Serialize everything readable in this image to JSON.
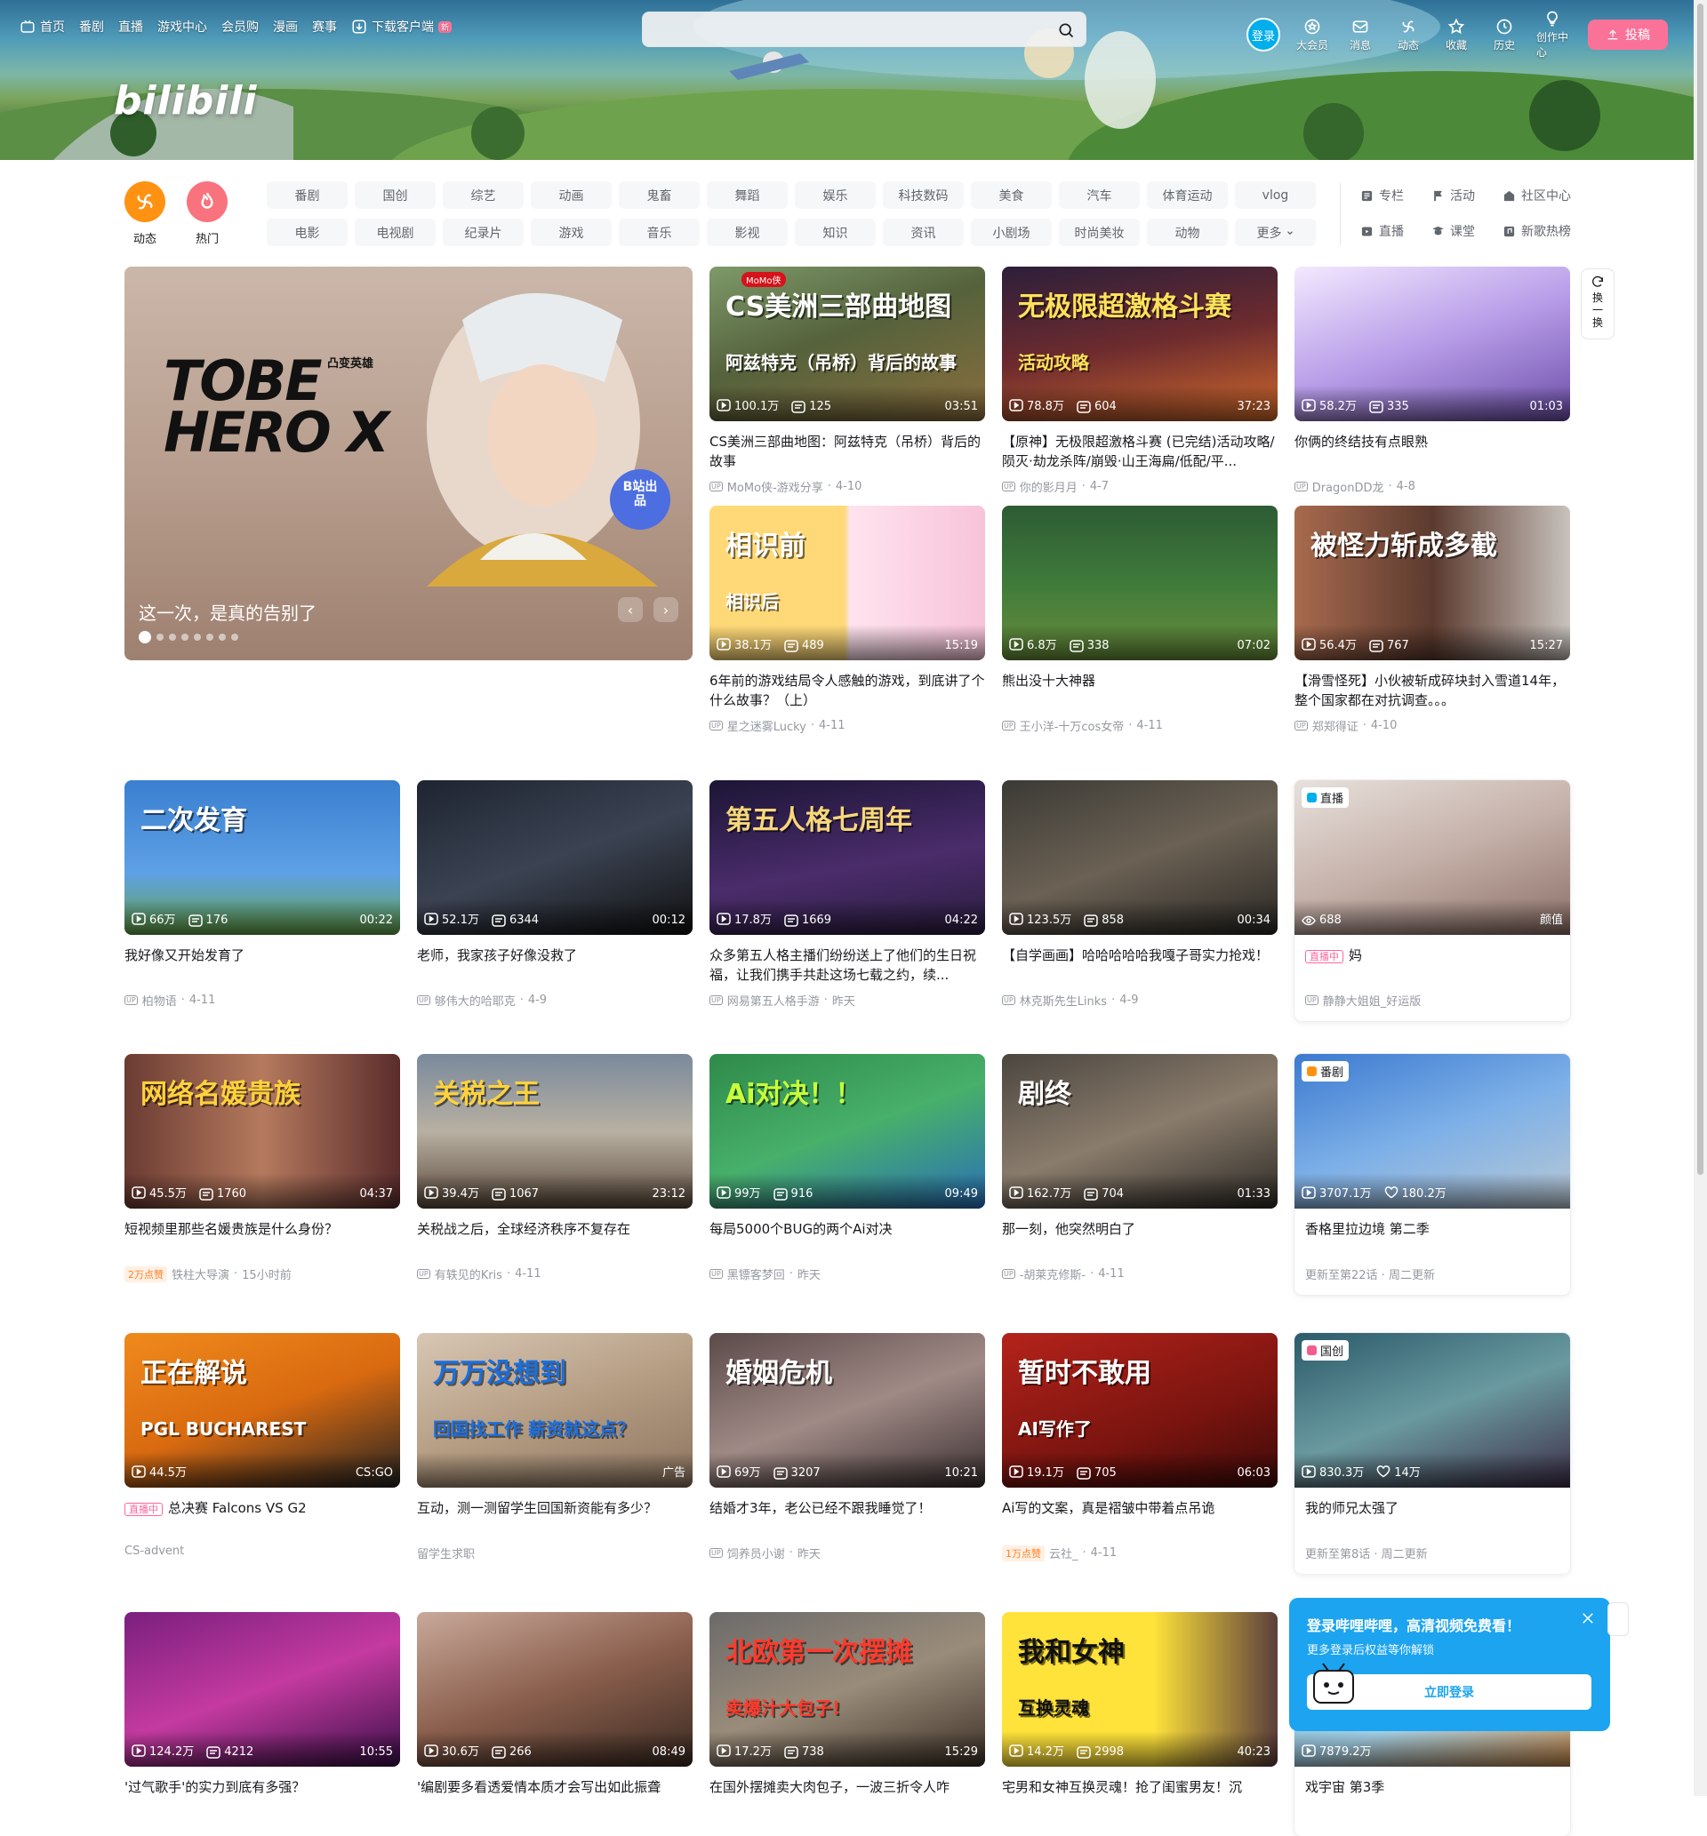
{
  "header": {
    "nav_left": [
      {
        "label": "首页",
        "icon": "tv-icon"
      },
      {
        "label": "番剧"
      },
      {
        "label": "直播"
      },
      {
        "label": "游戏中心"
      },
      {
        "label": "会员购"
      },
      {
        "label": "漫画"
      },
      {
        "label": "赛事"
      },
      {
        "label": "下载客户端",
        "icon": "download-icon",
        "badge": "新"
      }
    ],
    "logo_text": "bilibili",
    "search_placeholder": "",
    "login_label": "登录",
    "nav_right": [
      {
        "label": "大会员",
        "icon": "vip-icon"
      },
      {
        "label": "消息",
        "icon": "mail-icon"
      },
      {
        "label": "动态",
        "icon": "pinwheel-icon"
      },
      {
        "label": "收藏",
        "icon": "star-icon"
      },
      {
        "label": "历史",
        "icon": "clock-icon"
      },
      {
        "label": "创作中心",
        "icon": "bulb-icon"
      }
    ],
    "upload_label": "投稿"
  },
  "channels": {
    "circles": [
      {
        "label": "动态",
        "color": "#ff9212",
        "icon": "pinwheel-icon"
      },
      {
        "label": "热门",
        "color": "#f9737e",
        "icon": "flame-icon"
      }
    ],
    "categories": [
      "番剧",
      "国创",
      "综艺",
      "动画",
      "鬼畜",
      "舞蹈",
      "娱乐",
      "科技数码",
      "美食",
      "汽车",
      "体育运动",
      "vlog",
      "电影",
      "电视剧",
      "纪录片",
      "游戏",
      "音乐",
      "影视",
      "知识",
      "资讯",
      "小剧场",
      "时尚美妆",
      "动物",
      "更多"
    ],
    "extra_links": [
      {
        "label": "专栏",
        "icon": "column-icon"
      },
      {
        "label": "活动",
        "icon": "flag-icon"
      },
      {
        "label": "社区中心",
        "icon": "community-icon"
      },
      {
        "label": "直播",
        "icon": "live-icon"
      },
      {
        "label": "课堂",
        "icon": "class-icon"
      },
      {
        "label": "新歌热榜",
        "icon": "music-icon"
      }
    ]
  },
  "carousel": {
    "caption": "这一次，是真的告别了",
    "art_title": "TOBE HERO X",
    "art_subtitle": "凸变英雄",
    "badge": "B站出品",
    "dot_count": 8,
    "active_dot": 0
  },
  "refresh_label": [
    "换",
    "一",
    "换"
  ],
  "colors": {
    "brand_pink": "#fb7299",
    "brand_blue": "#00aeec",
    "popup_blue": "#1ca4f0"
  },
  "cards": [
    {
      "views": "100.1万",
      "danmaku": "125",
      "duration": "03:51",
      "title": "CS美洲三部曲地图：阿兹特克（吊桥）背后的故事",
      "author": "MoMo侠-游戏分享",
      "date": "4-10",
      "cover_text": "CS美洲三部曲地图",
      "cover_text2": "阿兹特克（吊桥）背后的故事",
      "tag_text": "MoMo侠",
      "bg": "linear-gradient(160deg,#7e9a6a,#55623c 45%,#8a6f3e 100%)",
      "tc": "#fff"
    },
    {
      "views": "78.8万",
      "danmaku": "604",
      "duration": "37:23",
      "title": "【原神】无极限超激格斗赛 (已完结)活动攻略/陨灭·劫龙杀阵/崩毁·山王海扁/低配/平...",
      "author": "你的影月月",
      "date": "4-7",
      "cover_text": "无极限超激格斗赛",
      "cover_text2": "活动攻略",
      "bg": "linear-gradient(170deg,#2c1f3a,#6d2b2e 50%,#d06a2c 100%)",
      "tc": "#ffe15a"
    },
    {
      "views": "58.2万",
      "danmaku": "335",
      "duration": "01:03",
      "title": "你俩的终结技有点眼熟",
      "author": "DragonDD龙",
      "date": "4-8",
      "cover_text": "",
      "bg": "linear-gradient(160deg,#f3e9ff,#b79ce8 50%,#6c4ea8 100%)",
      "tc": "#fff"
    },
    {
      "views": "38.1万",
      "danmaku": "489",
      "duration": "15:19",
      "title": "6年前的游戏结局令人感触的游戏，到底讲了个什么故事？（上）",
      "author": "星之迷雾Lucky",
      "date": "4-11",
      "cover_text": "相识前",
      "cover_text2": "相识后",
      "bg": "linear-gradient(90deg,#ffd978 0%,#ffd978 49%,#ffe3ef 51%,#f7c3d9 100%)",
      "tc": "#fff"
    },
    {
      "views": "6.8万",
      "danmaku": "338",
      "duration": "07:02",
      "title": "熊出没十大神器",
      "author": "王小洋-十万cos女帝",
      "date": "4-11",
      "cover_text": "",
      "bg": "linear-gradient(180deg,#2d5b34,#3f7a3a 50%,#6a8f3c 100%)",
      "tc": "#fff"
    },
    {
      "views": "56.4万",
      "danmaku": "767",
      "duration": "15:27",
      "title": "【滑雪怪死】小伙被斩成碎块封入雪道14年，整个国家都在对抗调查。。。",
      "author": "郑郑得证",
      "date": "4-10",
      "cover_text": "被怪力斩成多截",
      "bg": "linear-gradient(90deg,#a86a4e,#5b3a2e 50%,#c8c2bd 100%)",
      "tc": "#fff"
    },
    {
      "views": "66万",
      "danmaku": "176",
      "duration": "00:22",
      "title": "我好像又开始发育了",
      "author": "柏物语",
      "date": "4-11",
      "cover_text": "二次发育",
      "bg": "linear-gradient(180deg,#3a7fd0,#5ea1e6 60%,#66a44a 100%)",
      "tc": "#fff"
    },
    {
      "views": "52.1万",
      "danmaku": "6344",
      "duration": "00:12",
      "title": "老师，我家孩子好像没救了",
      "author": "够伟大的哈耶克",
      "date": "4-9",
      "cover_text": "",
      "bg": "linear-gradient(160deg,#1e2430,#3b4353 50%,#111 100%)",
      "tc": "#fff"
    },
    {
      "views": "17.8万",
      "danmaku": "1669",
      "duration": "04:22",
      "title": "众多第五人格主播们纷纷送上了他们的生日祝福，让我们携手共赴这场七载之约，续...",
      "author": "网易第五人格手游",
      "date": "昨天",
      "cover_text": "第五人格七周年",
      "bg": "linear-gradient(170deg,#1c1535,#4a2c6b 55%,#2b1d3f 100%)",
      "tc": "#f6d77b"
    },
    {
      "views": "123.5万",
      "danmaku": "858",
      "duration": "00:34",
      "title": "【自学画画】哈哈哈哈哈我嘎子哥实力抢戏！",
      "author": "林克斯先生Links",
      "date": "4-9",
      "cover_text": "",
      "bg": "linear-gradient(160deg,#3b3a35,#6b6154 50%,#2a2824 100%)",
      "tc": "#fff"
    },
    {
      "views": "2万点赞",
      "danmaku": "1760",
      "duration": "04:37",
      "title": "短视频里那些名媛贵族是什么身份？",
      "author": "铁柱大导演",
      "date": "15小时前",
      "cover_text": "网络名媛贵族",
      "bg": "linear-gradient(90deg,#6b3b32,#b57a5e 50%,#5a2c2c 100%)",
      "tc": "#ffd23b",
      "stats_views": "45.5万"
    },
    {
      "views": "39.4万",
      "danmaku": "1067",
      "duration": "23:12",
      "title": "关税战之后，全球经济秩序不复存在",
      "author": "有轶见的Kris",
      "date": "4-11",
      "cover_text": "关税之王",
      "bg": "linear-gradient(180deg,#7a8a9c,#b8b0a2 50%,#5b4a3c 100%)",
      "tc": "#ffd23b"
    },
    {
      "views": "99万",
      "danmaku": "916",
      "duration": "09:49",
      "title": "每局5000个BUG的两个Ai对决",
      "author": "黑镖客梦回",
      "date": "昨天",
      "cover_text": "Ai对决！！",
      "bg": "linear-gradient(160deg,#2f8a4a,#47b06a 50%,#2a6fb8 100%)",
      "tc": "#c7ff3a"
    },
    {
      "views": "162.7万",
      "danmaku": "704",
      "duration": "01:33",
      "title": "那一刻，他突然明白了",
      "author": "-胡莱克修斯-",
      "date": "4-11",
      "cover_text": "剧终",
      "bg": "linear-gradient(160deg,#4b4640,#8a7c6c 50%,#2d2a26 100%)",
      "tc": "#fff"
    },
    {
      "views": "44.5万",
      "danmaku": "",
      "duration": "CS:GO",
      "title": "总决赛 Falcons VS G2",
      "author": "CS-advent",
      "date": "",
      "cover_text": "正在解说",
      "cover_text2": "PGL BUCHAREST",
      "bg": "linear-gradient(160deg,#f08a1c,#d96a10 50%,#222 100%)",
      "tc": "#fff",
      "live": "直播中"
    },
    {
      "views": "",
      "danmaku": "",
      "duration": "广告",
      "title": "互动，测一测留学生回国新资能有多少？",
      "author": "留学生求职",
      "date": "",
      "cover_text": "万万没想到",
      "cover_text2": "回国找工作 薪资就这点？",
      "bg": "linear-gradient(160deg,#d8c7b4,#b59d83 50%,#8c7460 100%)",
      "tc": "#1a6fe0"
    },
    {
      "views": "69万",
      "danmaku": "3207",
      "duration": "10:21",
      "title": "结婚才3年，老公已经不跟我睡觉了！",
      "author": "饲养员小谢",
      "date": "昨天",
      "cover_text": "婚姻危机",
      "bg": "linear-gradient(160deg,#5b4a49,#a08a86 50%,#3b3031 100%)",
      "tc": "#fff"
    },
    {
      "views": "19.1万",
      "danmaku": "705",
      "duration": "06:03",
      "title": "Ai写的文案，真是褶皱中带着点吊诡",
      "author": "云社_",
      "date": "4-11",
      "cover_text": "暂时不敢用",
      "cover_text2": "AI写作了",
      "bg": "linear-gradient(160deg,#b4231b,#7a140f 60%,#3b0a08 100%)",
      "tc": "#fff",
      "hot": "1万点赞"
    },
    {
      "views": "124.2万",
      "danmaku": "4212",
      "duration": "10:55",
      "title": "'过气歌手'的实力到底有多强？",
      "author": "",
      "date": "",
      "cover_text": "",
      "bg": "linear-gradient(160deg,#7a1f7e,#c43aa0 50%,#3a0f48 100%)",
      "tc": "#fff"
    },
    {
      "views": "30.6万",
      "danmaku": "266",
      "duration": "08:49",
      "title": "'编剧要多看透爱情本质才会写出如此振聋",
      "author": "",
      "date": "",
      "cover_text": "",
      "bg": "linear-gradient(160deg,#c9a99a,#8a5e4c 50%,#3a2a22 100%)",
      "tc": "#fff"
    },
    {
      "views": "17.2万",
      "danmaku": "738",
      "duration": "15:29",
      "title": "在国外摆摊卖大肉包子，一波三折令人咋",
      "author": "",
      "date": "",
      "cover_text": "北欧第一次摆摊",
      "cover_text2": "卖爆汁大包子!",
      "bg": "linear-gradient(160deg,#6b6a6a,#9a8c7a 50%,#3d3026 100%)",
      "tc": "#ff3a2c"
    },
    {
      "views": "14.2万",
      "danmaku": "2998",
      "duration": "40:23",
      "title": "宅男和女神互换灵魂！抢了闺蜜男友！沉",
      "author": "",
      "date": "",
      "cover_text": "我和女神",
      "cover_text2": "互换灵魂",
      "bg": "linear-gradient(90deg,#ffe23a 0%,#ffe23a 55%,#5b3e3b 100%)",
      "tc": "#111"
    }
  ],
  "specials": [
    {
      "tag": "直播",
      "tag_color": "#00aeec",
      "stat1": "688",
      "right": "颜值",
      "title": "妈",
      "meta_live": "直播中",
      "author": "静静大姐姐_好运版",
      "bg": "linear-gradient(160deg,#e8e1dc,#c4b0a8 50%,#8c7068 100%)"
    },
    {
      "tag": "番剧",
      "tag_color": "#ff9212",
      "stat1": "3707.1万",
      "stat2": "180.2万",
      "title": "香格里拉边境 第二季",
      "meta": "更新至第22话 · 周二更新",
      "bg": "linear-gradient(160deg,#3c7ad0,#7db0e8 50%,#b9c8d4 100%)"
    },
    {
      "tag": "国创",
      "tag_color": "#f25d8e",
      "stat1": "830.3万",
      "stat2": "14万",
      "title": "我的师兄太强了",
      "meta": "更新至第8话 · 周二更新",
      "bg": "linear-gradient(160deg,#2b5a6a,#6a9aa0 50%,#3e2f48 100%)"
    },
    {
      "tag": "",
      "stat1": "7879.2万",
      "title": "戏宇宙 第3季",
      "bg": "linear-gradient(160deg,#6ab0d8,#a4d0e6 60%,#c98a4a 100%)"
    }
  ],
  "login_popup": {
    "title": "登录哔哩哔哩，高清视频免费看！",
    "subtitle": "更多登录后权益等你解锁",
    "button": "立即登录"
  }
}
